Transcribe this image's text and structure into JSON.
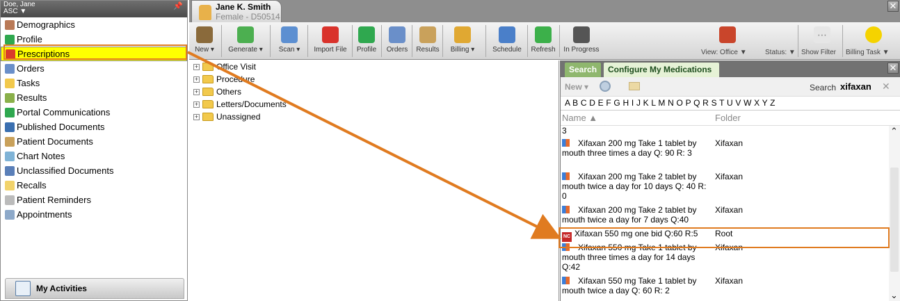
{
  "sidebar": {
    "user": "Doe, Jane",
    "location": "ASC",
    "items": [
      {
        "label": "Demographics",
        "icon": "person-icon",
        "color": "#b97a57"
      },
      {
        "label": "Profile",
        "icon": "plus-icon",
        "color": "#2fa84f"
      },
      {
        "label": "Prescriptions",
        "icon": "prescription-icon",
        "color": "#d93a2b"
      },
      {
        "label": "Orders",
        "icon": "doctor-icon",
        "color": "#6a8fc9"
      },
      {
        "label": "Tasks",
        "icon": "tasks-icon",
        "color": "#f2c94c"
      },
      {
        "label": "Results",
        "icon": "results-icon",
        "color": "#8ab04a"
      },
      {
        "label": "Portal Communications",
        "icon": "portal-icon",
        "color": "#2fa84f"
      },
      {
        "label": "Published Documents",
        "icon": "published-icon",
        "color": "#3a6fb0"
      },
      {
        "label": "Patient Documents",
        "icon": "patient-documents-icon",
        "color": "#c9a15b"
      },
      {
        "label": "Chart Notes",
        "icon": "chart-notes-icon",
        "color": "#7fb3d6"
      },
      {
        "label": "Unclassified Documents",
        "icon": "unclassified-icon",
        "color": "#5a7fb8"
      },
      {
        "label": "Recalls",
        "icon": "recalls-icon",
        "color": "#f2d36b"
      },
      {
        "label": "Patient Reminders",
        "icon": "reminders-icon",
        "color": "#bbbbbb"
      },
      {
        "label": "Appointments",
        "icon": "calendar-icon",
        "color": "#8da9c9"
      }
    ],
    "active_index": 2,
    "bottom_label": "My Activities"
  },
  "patient": {
    "name": "Jane K. Smith",
    "info": "Female - D50514"
  },
  "toolbar": {
    "buttons": [
      {
        "label": "New",
        "icon": "new-icon",
        "color": "#8a6a3b",
        "dropdown": true
      },
      {
        "label": "Generate",
        "icon": "generate-icon",
        "color": "#4caf50",
        "dropdown": true
      },
      {
        "label": "Scan",
        "icon": "scan-icon",
        "color": "#5c8fd1",
        "dropdown": true
      },
      {
        "label": "Import File",
        "icon": "import-icon",
        "color": "#d9322b",
        "dropdown": false
      },
      {
        "label": "Profile",
        "icon": "profile-icon",
        "color": "#2fa84f",
        "dropdown": false
      },
      {
        "label": "Orders",
        "icon": "orders-icon",
        "color": "#6a8fc9",
        "dropdown": false
      },
      {
        "label": "Results",
        "icon": "results-icon",
        "color": "#c9a15b",
        "dropdown": false
      },
      {
        "label": "Billing",
        "icon": "billing-icon",
        "color": "#e0a832",
        "dropdown": true
      },
      {
        "label": "Schedule",
        "icon": "schedule-icon",
        "color": "#4a7fc9",
        "dropdown": false
      },
      {
        "label": "Refresh",
        "icon": "refresh-icon",
        "color": "#3cb04a",
        "dropdown": false
      },
      {
        "label": "In Progress",
        "icon": "in-progress-icon",
        "color": "#555555",
        "dropdown": false
      }
    ],
    "right": {
      "view_label": "View: Office",
      "status_label": "Status:",
      "show_filter": "Show Filter",
      "billing_task": "Billing Task"
    }
  },
  "tree": {
    "items": [
      "Office Visit",
      "Procedure",
      "Others",
      "Letters/Documents",
      "Unassigned"
    ]
  },
  "panel": {
    "tab_search": "Search",
    "tab_config": "Configure My Medications",
    "new_label": "New",
    "search_label": "Search",
    "search_value": "xifaxan",
    "alphabet": "A B C D E F G H I J K L M N O P Q R S T U V W X Y Z",
    "col_name": "Name",
    "col_folder": "Folder",
    "rows": [
      {
        "name": "3",
        "folder": "",
        "type": "partial"
      },
      {
        "name": "Xifaxan 200 mg Take 1 tablet by mouth three times a day Q: 90 R: 3",
        "folder": "Xifaxan",
        "type": "ib"
      },
      {
        "name": "Xifaxan 200 mg Take 2 tablet by mouth twice a day for 10 days Q: 40 R: 0",
        "folder": "Xifaxan",
        "type": "ib"
      },
      {
        "name": "Xifaxan 200 mg Take 2 tablet by mouth twice a day for 7 days Q:40",
        "folder": "Xifaxan",
        "type": "ib"
      },
      {
        "name": "Xifaxan 550 mg one bid Q:60 R:5",
        "folder": "Root",
        "type": "nc"
      },
      {
        "name": "Xifaxan 550 mg Take 1 tablet by mouth three times a day for 14 days Q:42",
        "folder": "Xifaxan",
        "type": "ib"
      },
      {
        "name": "Xifaxan 550 mg Take 1 tablet by mouth twice a day Q: 60 R: 2",
        "folder": "Xifaxan",
        "type": "ib"
      }
    ],
    "ib_badge": "IB",
    "nc_badge": "NC"
  },
  "annotation_color": "#e07b20"
}
